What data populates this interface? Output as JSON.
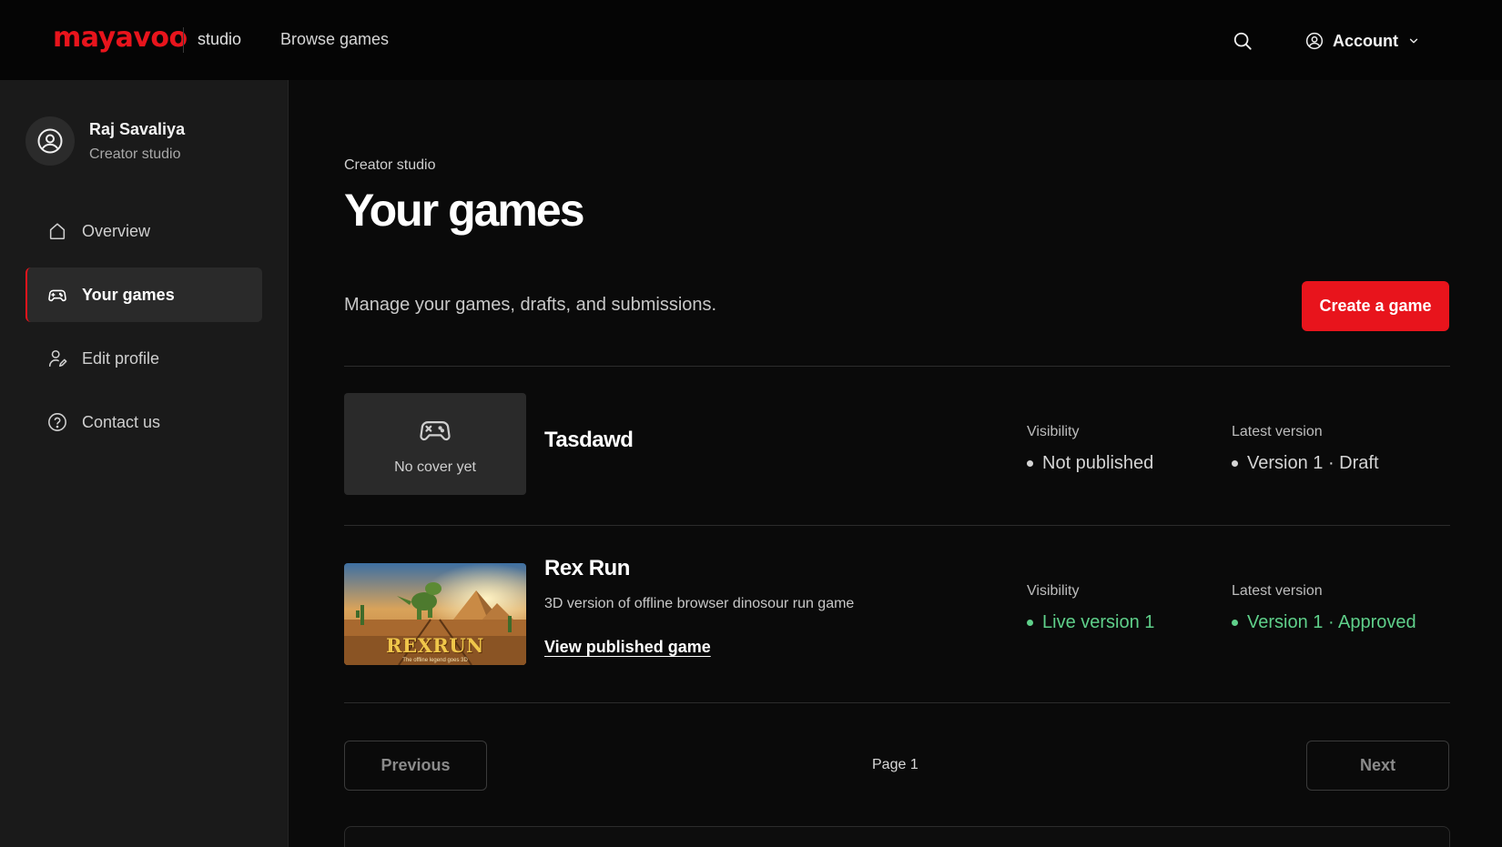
{
  "header": {
    "logo": "mayavoo",
    "logo_suffix": "studio",
    "browse_label": "Browse games",
    "account_label": "Account"
  },
  "sidebar": {
    "user_name": "Raj Savaliya",
    "user_subtitle": "Creator studio",
    "items": [
      {
        "label": "Overview",
        "icon": "home-icon"
      },
      {
        "label": "Your games",
        "icon": "gamepad-icon",
        "active": true
      },
      {
        "label": "Edit profile",
        "icon": "user-edit-icon"
      },
      {
        "label": "Contact us",
        "icon": "help-circle-icon"
      }
    ]
  },
  "main": {
    "eyebrow": "Creator studio",
    "title": "Your games",
    "subtitle": "Manage your games, drafts, and submissions.",
    "create_button": "Create a game",
    "games": [
      {
        "title": "Tasdawd",
        "cover_placeholder": "No cover yet",
        "visibility_label": "Visibility",
        "visibility_value": "Not published",
        "version_label": "Latest version",
        "version_value": "Version 1 · Draft"
      },
      {
        "title": "Rex Run",
        "description": "3D version of offline browser dinosour run game",
        "link": "View published game",
        "cover_title": "REXRUN",
        "cover_tagline": "The offline legend goes 3D",
        "visibility_label": "Visibility",
        "visibility_value": "Live version 1",
        "version_label": "Latest version",
        "version_value": "Version 1 · Approved"
      }
    ],
    "pagination": {
      "previous": "Previous",
      "page_label": "Page 1",
      "next": "Next"
    }
  },
  "colors": {
    "accent": "#e8141c",
    "success": "#5fd08a",
    "background": "#0a0a0a",
    "sidebar": "#1a1a1a"
  }
}
